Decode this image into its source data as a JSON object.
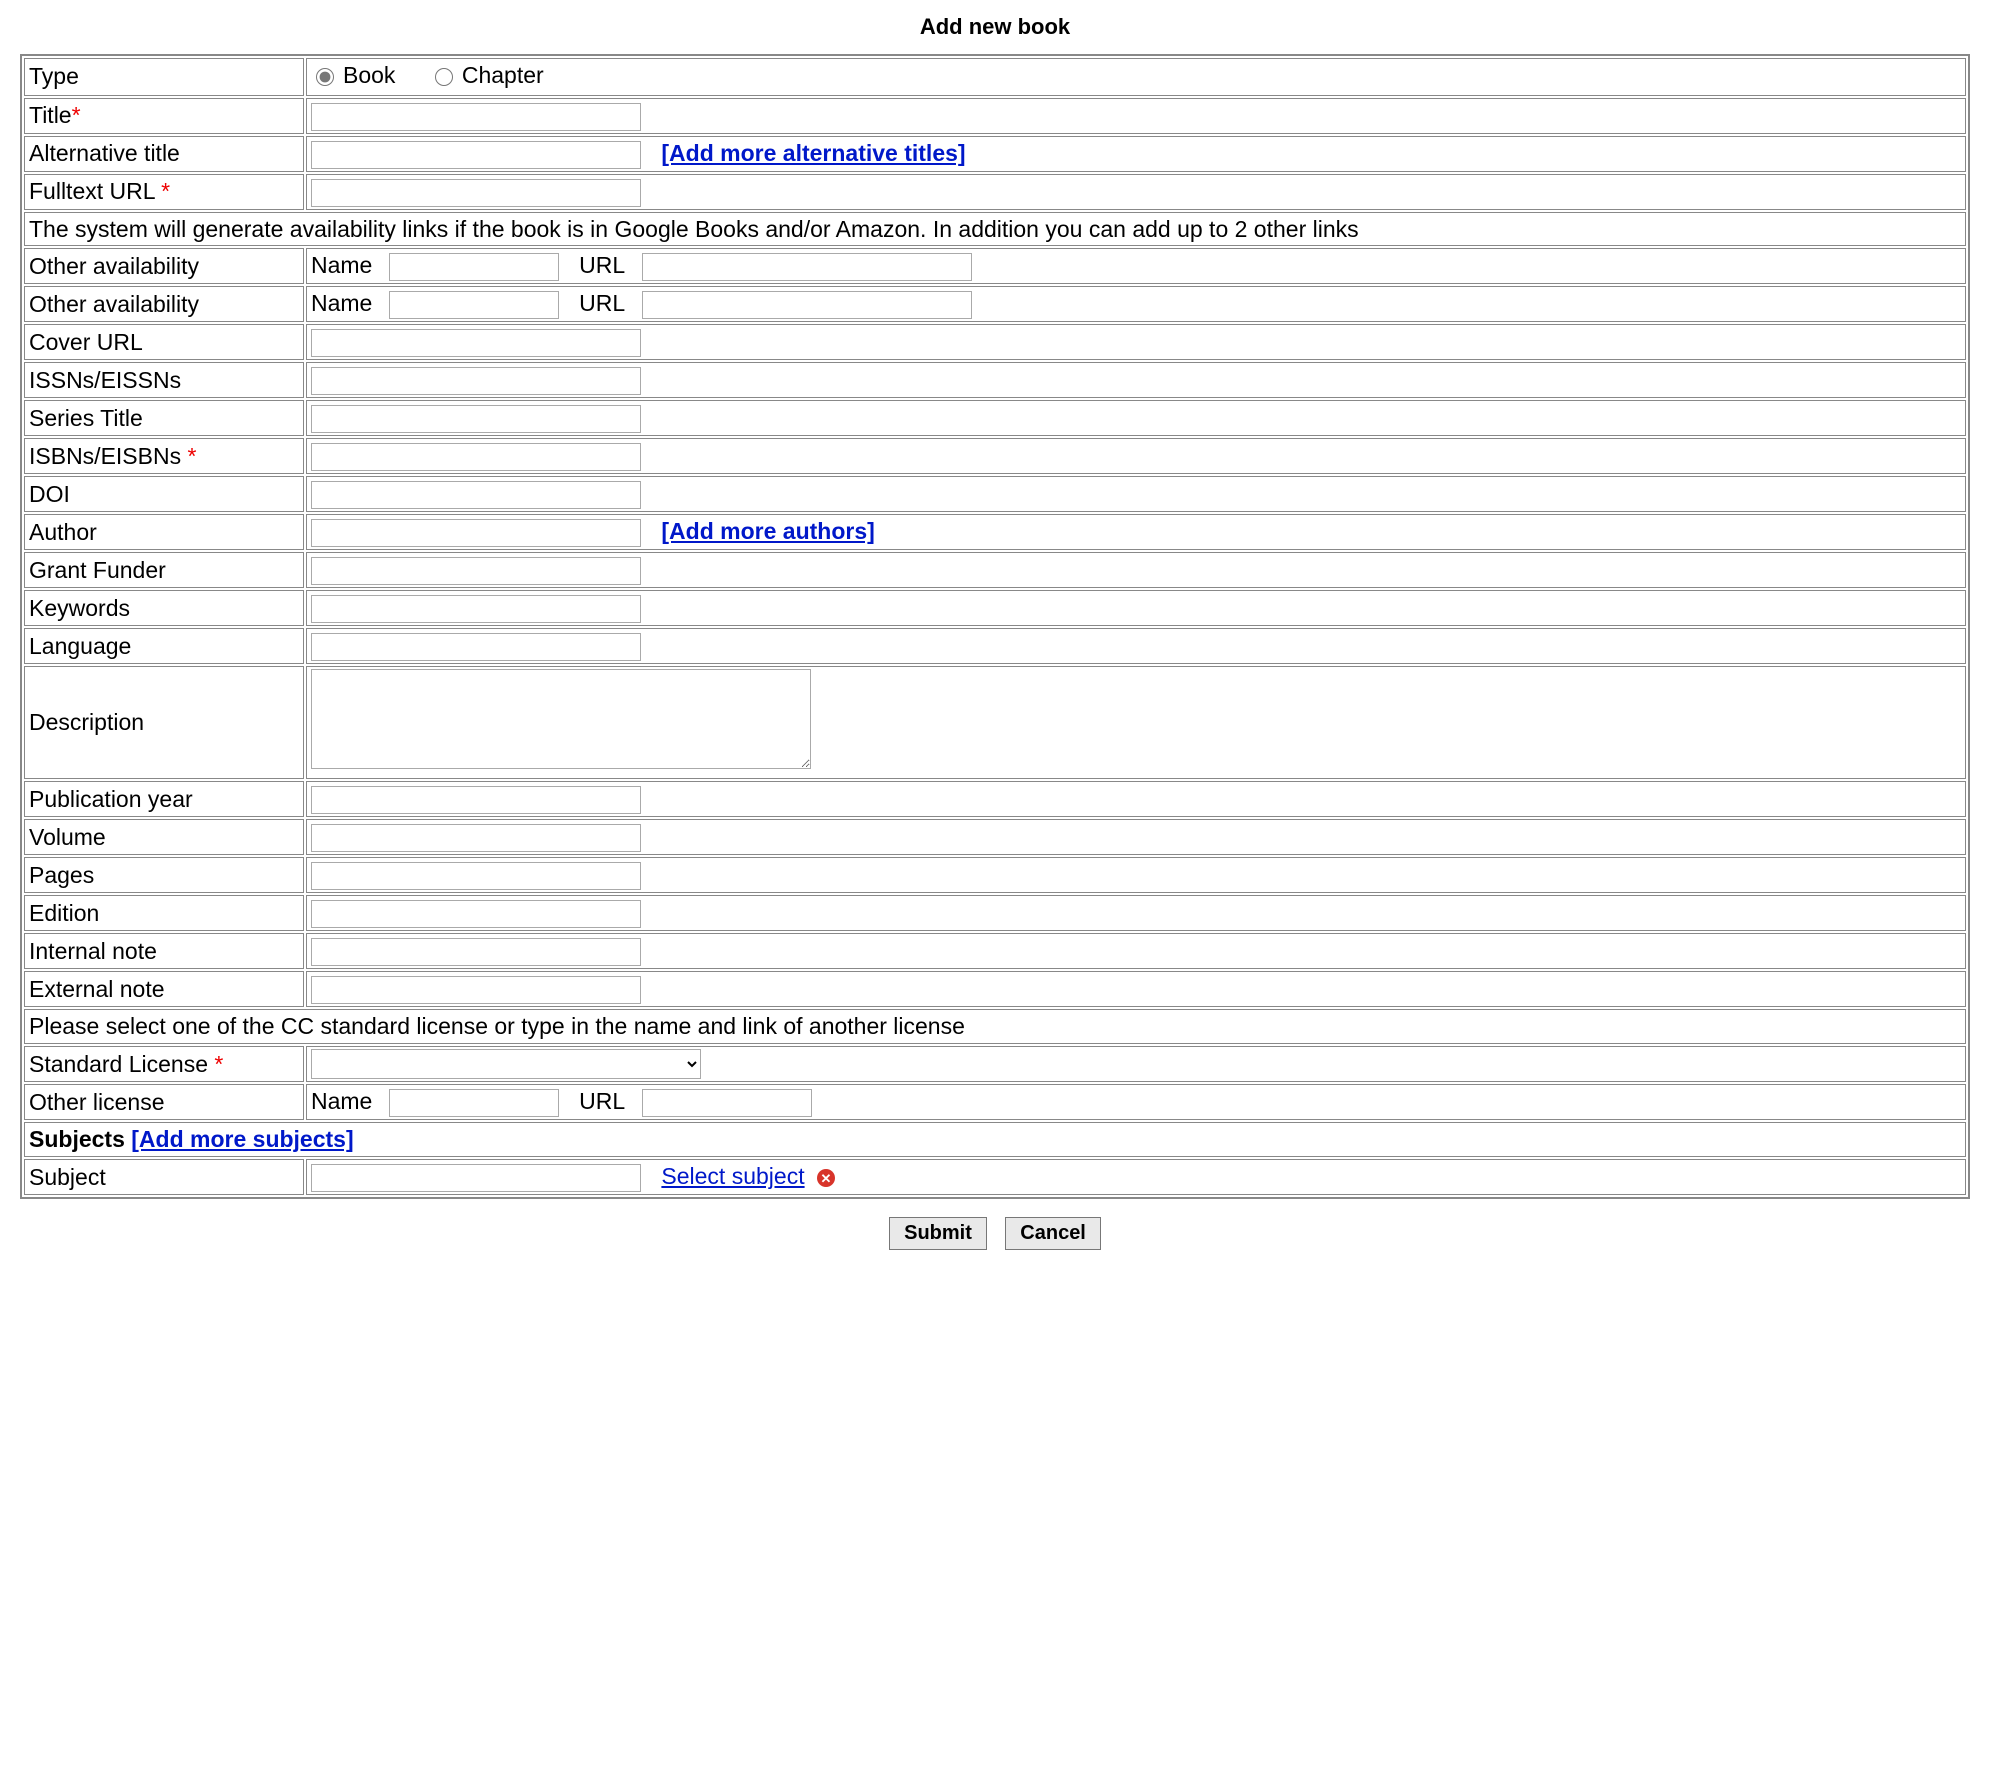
{
  "page_title": "Add new book",
  "labels": {
    "type": "Type",
    "title": "Title",
    "alt_title": "Alternative title",
    "fulltext_url": "Fulltext URL",
    "availability_note": "The system will generate availability links if the book is in Google Books and/or Amazon. In addition you can add up to 2 other links",
    "other_availability": "Other availability",
    "name": "Name",
    "url": "URL",
    "cover_url": "Cover URL",
    "issns": "ISSNs/EISSNs",
    "series_title": "Series Title",
    "isbns": "ISBNs/EISBNs",
    "doi": "DOI",
    "author": "Author",
    "grant_funder": "Grant Funder",
    "keywords": "Keywords",
    "language": "Language",
    "description": "Description",
    "pub_year": "Publication year",
    "volume": "Volume",
    "pages": "Pages",
    "edition": "Edition",
    "internal_note": "Internal note",
    "external_note": "External note",
    "license_note": "Please select one of the CC standard license or type in the name and link of another license",
    "standard_license": "Standard License",
    "other_license": "Other license",
    "subjects": "Subjects",
    "subject": "Subject",
    "asterisk": "*"
  },
  "type_options": {
    "book": "Book",
    "chapter": "Chapter",
    "selected": "book"
  },
  "links": {
    "add_alt_titles": "[Add more alternative titles]",
    "add_authors": "[Add more authors]",
    "add_subjects": "[Add more subjects]",
    "select_subject": "Select subject"
  },
  "buttons": {
    "submit": "Submit",
    "cancel": "Cancel"
  },
  "values": {
    "title": "",
    "alt_title": "",
    "fulltext_url": "",
    "other_avail_1_name": "",
    "other_avail_1_url": "",
    "other_avail_2_name": "",
    "other_avail_2_url": "",
    "cover_url": "",
    "issns": "",
    "series_title": "",
    "isbns": "",
    "doi": "",
    "author": "",
    "grant_funder": "",
    "keywords": "",
    "language": "",
    "description": "",
    "pub_year": "",
    "volume": "",
    "pages": "",
    "edition": "",
    "internal_note": "",
    "external_note": "",
    "standard_license": "",
    "other_license_name": "",
    "other_license_url": "",
    "subject": ""
  }
}
